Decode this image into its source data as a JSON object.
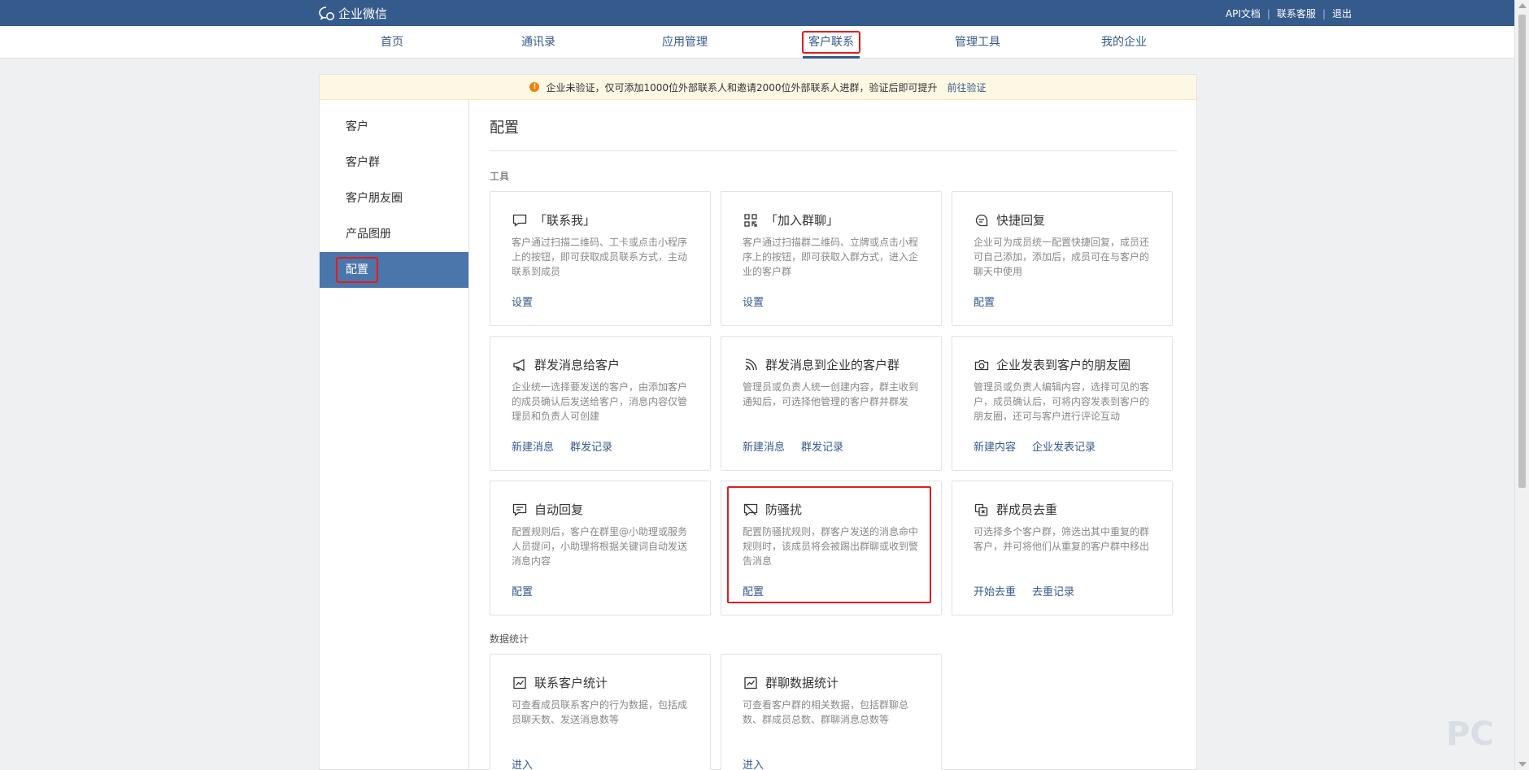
{
  "topbar": {
    "logo_text": "企业微信",
    "links": [
      "API文档",
      "联系客服",
      "退出"
    ]
  },
  "nav": {
    "items": [
      "首页",
      "通讯录",
      "应用管理",
      "客户联系",
      "管理工具",
      "我的企业"
    ],
    "active_index": 3
  },
  "notice": {
    "text": "企业未验证，仅可添加1000位外部联系人和邀请2000位外部联系人进群，验证后即可提升",
    "link": "前往验证"
  },
  "sidebar": {
    "items": [
      "客户",
      "客户群",
      "客户朋友圈",
      "产品图册",
      "配置"
    ],
    "active_index": 4
  },
  "content": {
    "title": "配置",
    "tools_section": "工具",
    "stats_section": "数据统计",
    "tools": [
      {
        "icon": "chat-bubble-icon",
        "title": "「联系我」",
        "desc": "客户通过扫描二维码、工卡或点击小程序上的按钮，即可获取成员联系方式，主动联系到成员",
        "actions": [
          "设置"
        ]
      },
      {
        "icon": "qrcode-icon",
        "title": "「加入群聊」",
        "desc": "客户通过扫描群二维码、立牌或点击小程序上的按钮，即可获取入群方式，进入企业的客户群",
        "actions": [
          "设置"
        ]
      },
      {
        "icon": "quick-reply-icon",
        "title": "快捷回复",
        "desc": "企业可为成员统一配置快捷回复，成员还可自己添加，添加后，成员可在与客户的聊天中使用",
        "actions": [
          "配置"
        ]
      },
      {
        "icon": "megaphone-icon",
        "title": "群发消息给客户",
        "desc": "企业统一选择要发送的客户，由添加客户的成员确认后发送给客户，消息内容仅管理员和负责人可创建",
        "actions": [
          "新建消息",
          "群发记录"
        ]
      },
      {
        "icon": "broadcast-icon",
        "title": "群发消息到企业的客户群",
        "desc": "管理员或负责人统一创建内容，群主收到通知后，可选择他管理的客户群并群发",
        "actions": [
          "新建消息",
          "群发记录"
        ]
      },
      {
        "icon": "camera-icon",
        "title": "企业发表到客户的朋友圈",
        "desc": "管理员或负责人编辑内容，选择可见的客户，成员确认后，可将内容发表到客户的朋友圈，还可与客户进行评论互动",
        "actions": [
          "新建内容",
          "企业发表记录"
        ]
      },
      {
        "icon": "auto-reply-icon",
        "title": "自动回复",
        "desc": "配置规则后，客户在群里@小助理或服务人员提问，小助理将根据关键词自动发送消息内容",
        "actions": [
          "配置"
        ]
      },
      {
        "icon": "anti-harass-icon",
        "title": "防骚扰",
        "desc": "配置防骚扰规则，群客户发送的消息命中规则时，该成员将会被踢出群聊或收到警告消息",
        "actions": [
          "配置"
        ]
      },
      {
        "icon": "dedupe-icon",
        "title": "群成员去重",
        "desc": "可选择多个客户群，筛选出其中重复的群客户，并可将他们从重复的客户群中移出",
        "actions": [
          "开始去重",
          "去重记录"
        ]
      }
    ],
    "stats": [
      {
        "icon": "line-chart-icon",
        "title": "联系客户统计",
        "desc": "可查看成员联系客户的行为数据，包括成员聊天数、发送消息数等",
        "actions": [
          "进入"
        ]
      },
      {
        "icon": "line-chart-icon",
        "title": "群聊数据统计",
        "desc": "可查看客户群的相关数据，包括群聊总数、群成员总数、群聊消息总数等",
        "actions": [
          "进入"
        ]
      }
    ]
  },
  "colors": {
    "brand": "#355a8c",
    "sidebar_active": "#4a76ab",
    "highlight": "#e41b1b"
  }
}
